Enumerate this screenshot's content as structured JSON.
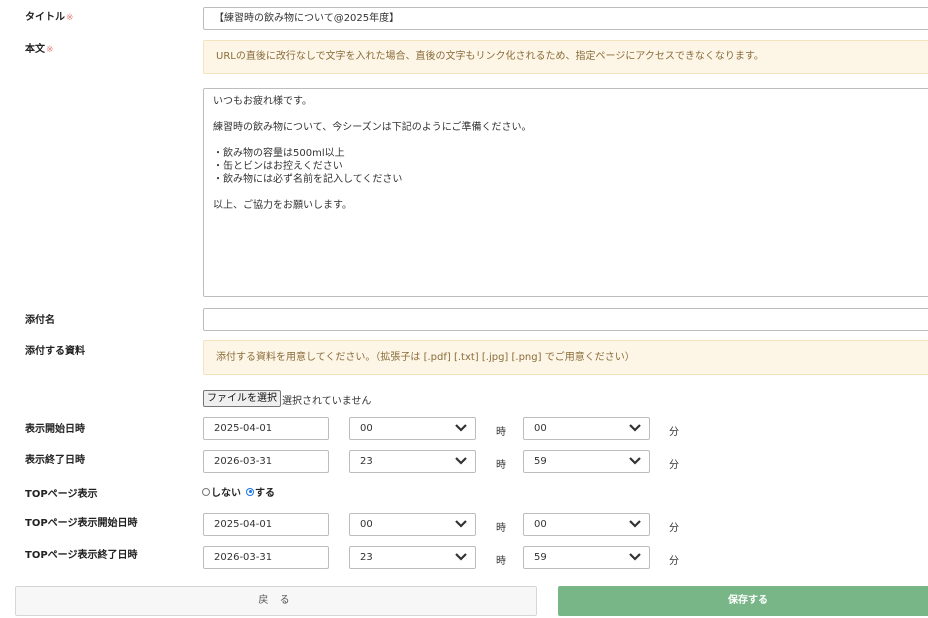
{
  "form": {
    "title_label": "タイトル",
    "required_mark": "※",
    "title_value": "【練習時の飲み物について@2025年度】",
    "body_label": "本文",
    "body_note": "URLの直後に改行なしで文字を入れた場合、直後の文字もリンク化されるため、指定ページにアクセスできなくなります。",
    "body_value": "いつもお疲れ様です。\n\n練習時の飲み物について、今シーズンは下記のようにご準備ください。\n\n・飲み物の容量は500ml以上\n・缶とビンはお控えください\n・飲み物には必ず名前を記入してください\n\n以上、ご協力をお願いします。",
    "attachment_name_label": "添付名",
    "attachment_name_value": "",
    "attachment_file_label": "添付する資料",
    "attachment_note": "添付する資料を用意してください。（拡張子は [.pdf] [.txt] [.jpg] [.png] でご用意ください）",
    "file_button_label": "ファイルを選択",
    "file_status": "選択されていません",
    "display_start_label": "表示開始日時",
    "display_start_date": "2025-04-01",
    "display_start_hour": "00",
    "display_start_minute": "00",
    "display_end_label": "表示終了日時",
    "display_end_date": "2026-03-31",
    "display_end_hour": "23",
    "display_end_minute": "59",
    "top_display_label": "TOPページ表示",
    "top_display_off": "しない",
    "top_display_on": "する",
    "top_display_selected": "する",
    "top_start_label": "TOPページ表示開始日時",
    "top_start_date": "2025-04-01",
    "top_start_hour": "00",
    "top_start_minute": "00",
    "top_end_label": "TOPページ表示終了日時",
    "top_end_date": "2026-03-31",
    "top_end_hour": "23",
    "top_end_minute": "59",
    "hour_unit": "時",
    "minute_unit": "分"
  },
  "actions": {
    "back_label": "戻 る",
    "save_label": "保存する"
  },
  "colors": {
    "required": "#e0867f",
    "note_bg": "#fdf5e6",
    "save_bg": "#78b688",
    "radio_accent": "#1a73e8"
  }
}
